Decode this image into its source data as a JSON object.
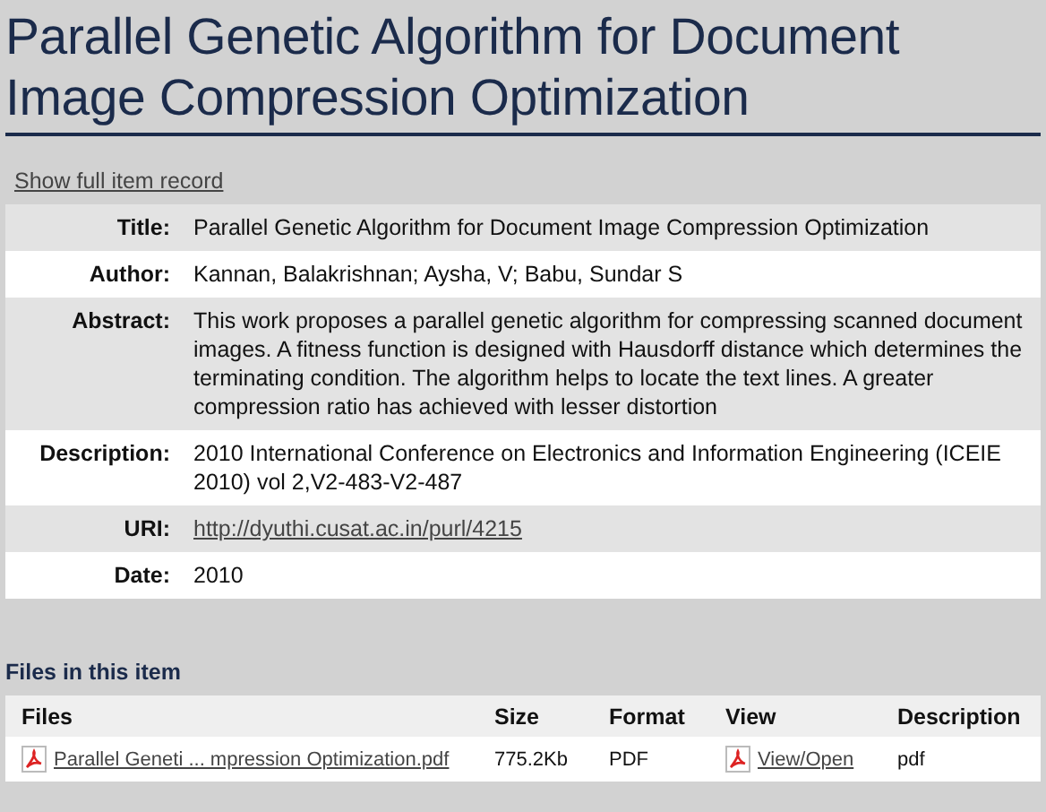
{
  "heading": "Parallel Genetic Algorithm for Document Image Compression Optimization",
  "full_record_link": "Show full item record",
  "metadata": [
    {
      "label": "Title:",
      "value": "Parallel Genetic Algorithm for Document Image Compression Optimization",
      "kind": "text"
    },
    {
      "label": "Author:",
      "value": "Kannan, Balakrishnan; Aysha, V; Babu, Sundar S",
      "kind": "text"
    },
    {
      "label": "Abstract:",
      "value": "This work proposes a parallel genetic algorithm for compressing scanned document images. A fitness function is designed with Hausdorff distance which determines the terminating condition. The algorithm helps to locate the text lines. A greater compression ratio has achieved with lesser distortion",
      "kind": "text"
    },
    {
      "label": "Description:",
      "value": "2010 International Conference on Electronics and Information Engineering (ICEIE 2010) vol 2,V2-483-V2-487",
      "kind": "text"
    },
    {
      "label": "URI:",
      "value": "http://dyuthi.cusat.ac.in/purl/4215",
      "kind": "link"
    },
    {
      "label": "Date:",
      "value": "2010",
      "kind": "text"
    }
  ],
  "files_heading": "Files in this item",
  "files_table": {
    "columns": [
      "Files",
      "Size",
      "Format",
      "View",
      "Description"
    ],
    "rows": [
      {
        "file": "Parallel Geneti ... mpression Optimization.pdf",
        "size": "775.2Kb",
        "format": "PDF",
        "view": "View/Open",
        "description": "pdf"
      }
    ]
  }
}
